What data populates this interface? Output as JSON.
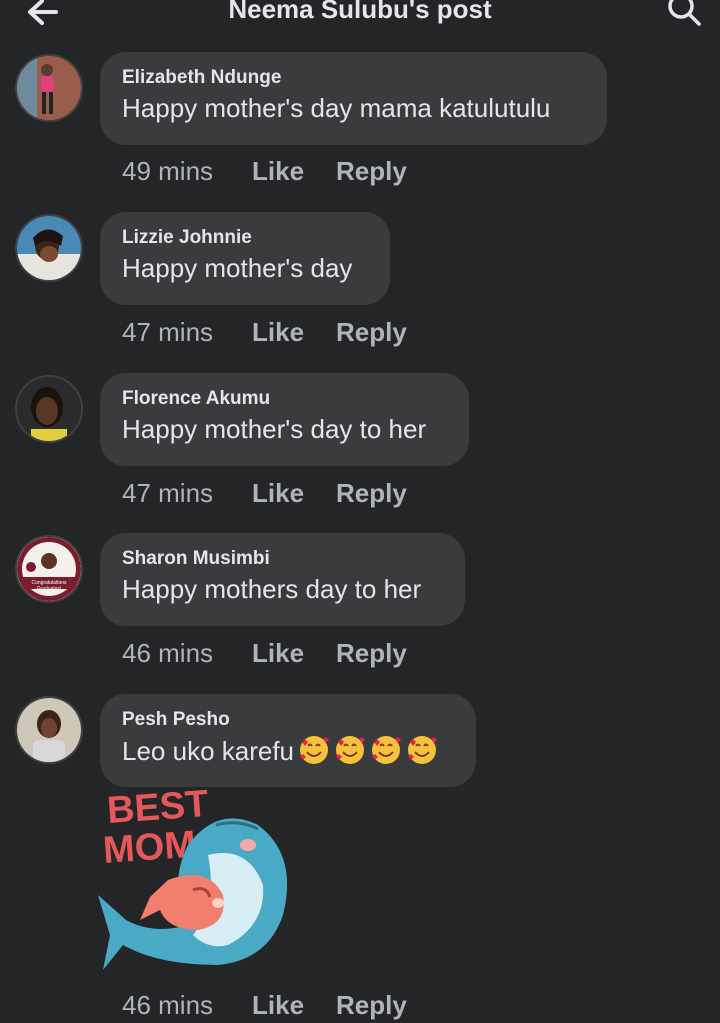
{
  "header": {
    "title": "Neema Sulubu's post",
    "back_icon": "arrow-left-icon",
    "search_icon": "search-icon"
  },
  "colors": {
    "background": "#242526",
    "bubble": "#3a3b3c",
    "text": "#e4e6eb",
    "meta": "#b0b3b8",
    "sticker_accent": "#e4585c",
    "sticker_dolphin": "#4aa9c4"
  },
  "comments": [
    {
      "author": "Elizabeth Ndunge",
      "text": "Happy mother's day mama katulutulu",
      "time": "49 mins",
      "like": "Like",
      "reply": "Reply"
    },
    {
      "author": "Lizzie Johnnie",
      "text": "Happy mother's day",
      "time": "47 mins",
      "like": "Like",
      "reply": "Reply"
    },
    {
      "author": "Florence Akumu",
      "text": "Happy mother's day to her",
      "time": "47 mins",
      "like": "Like",
      "reply": "Reply"
    },
    {
      "author": "Sharon Musimbi",
      "text": "Happy mothers day to her",
      "time": "46 mins",
      "like": "Like",
      "reply": "Reply",
      "avatar_text": "Congratulations Graduates!"
    },
    {
      "author": "Pesh Pesho",
      "text": "Leo uko karefu",
      "emoji": "smiling-face-with-hearts",
      "emoji_count": 4,
      "sticker": {
        "text_line1": "BEST",
        "text_line2": "MOM",
        "icon": "dolphin-hug-sticker"
      },
      "time": "46 mins",
      "like": "Like",
      "reply": "Reply"
    }
  ]
}
